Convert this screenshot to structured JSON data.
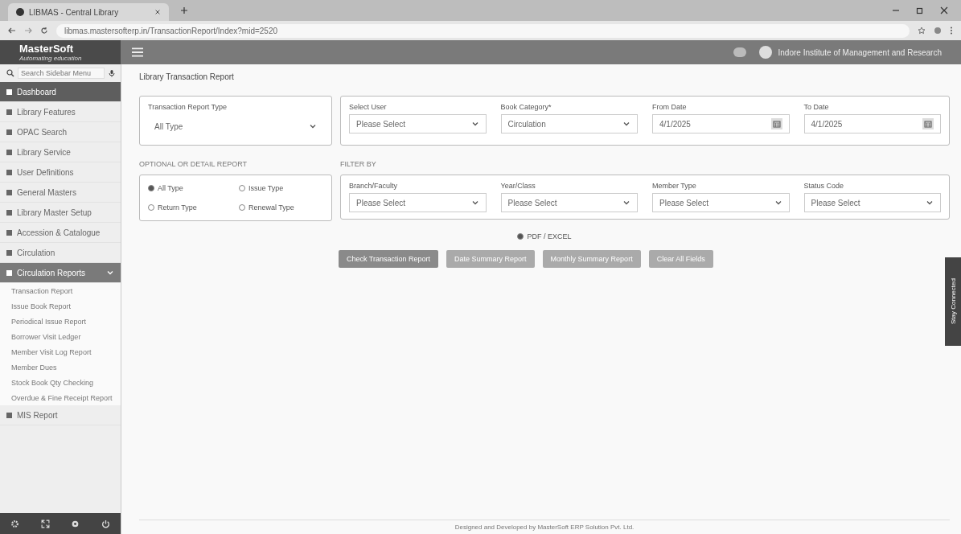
{
  "browser": {
    "tab_title": "LIBMAS - Central Library",
    "url": "libmas.mastersofterp.in/TransactionReport/Index?mid=2520"
  },
  "header": {
    "logo": "MasterSoft",
    "tagline": "Automating education",
    "institute": "Indore Institute of Management and Research"
  },
  "sidebar": {
    "search": {
      "placeholder": "Search Sidebar Menu"
    },
    "items": [
      {
        "label": "Dashboard",
        "selected": true
      },
      {
        "label": "Library Features",
        "selected": false
      },
      {
        "label": "OPAC Search",
        "selected": false
      },
      {
        "label": "Library Service",
        "selected": false
      },
      {
        "label": "User Definitions",
        "selected": false
      },
      {
        "label": "General Masters",
        "selected": false
      },
      {
        "label": "Library Master Setup",
        "selected": false
      },
      {
        "label": "Accession & Catalogue",
        "selected": false
      },
      {
        "label": "Circulation",
        "selected": false
      },
      {
        "label": "Circulation Reports",
        "selected": false,
        "expanded": true,
        "children": [
          {
            "label": "Transaction Report"
          },
          {
            "label": "Issue Book Report"
          },
          {
            "label": "Periodical Issue Report"
          },
          {
            "label": "Borrower Visit Ledger"
          },
          {
            "label": "Member Visit Log Report"
          },
          {
            "label": "Member Dues"
          },
          {
            "label": "Stock Book Qty Checking"
          },
          {
            "label": "Overdue & Fine Receipt Report"
          }
        ]
      },
      {
        "label": "MIS Report",
        "selected": false
      }
    ]
  },
  "page": {
    "title": "Library Transaction Report",
    "report_type": {
      "label": "Transaction Report Type",
      "value": "All Type"
    },
    "top_fields": [
      {
        "label": "Select User",
        "value": "Please Select",
        "kind": "select"
      },
      {
        "label": "Book Category*",
        "value": "Circulation",
        "kind": "select"
      },
      {
        "label": "From Date",
        "value": "4/1/2025",
        "kind": "date"
      },
      {
        "label": "To Date",
        "value": "4/1/2025",
        "kind": "date"
      }
    ],
    "options_heading": "OPTIONAL OR DETAIL REPORT",
    "options": [
      {
        "label": "All Type",
        "selected": true
      },
      {
        "label": "Issue Type",
        "selected": false
      },
      {
        "label": "Return Type",
        "selected": false
      },
      {
        "label": "Renewal Type",
        "selected": false
      }
    ],
    "filter_heading": "FILTER BY",
    "filters": [
      {
        "label": "Branch/Faculty",
        "value": "Please Select"
      },
      {
        "label": "Year/Class",
        "value": "Please Select"
      },
      {
        "label": "Member Type",
        "value": "Please Select"
      },
      {
        "label": "Status Code",
        "value": "Please Select"
      }
    ],
    "format": {
      "label": "PDF / EXCEL",
      "selected": true
    },
    "buttons": [
      "Check Transaction Report",
      "Date Summary Report",
      "Monthly Summary Report",
      "Clear All Fields"
    ],
    "side_tab": "Stay Connected"
  },
  "footer": "Designed and Developed by MasterSoft ERP Solution Pvt. Ltd."
}
